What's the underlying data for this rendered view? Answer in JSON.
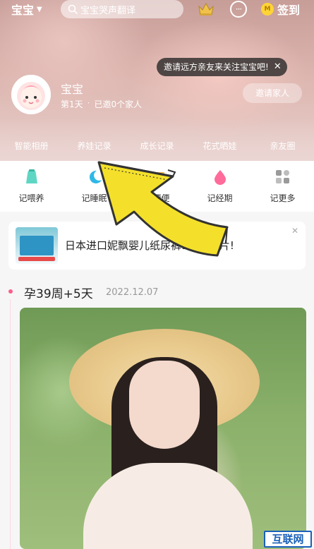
{
  "topbar": {
    "profile_name": "宝宝",
    "search_placeholder": "宝宝哭声翻译",
    "checkin_label": "签到",
    "coin_icon": "M"
  },
  "tooltip": {
    "text": "邀请远方亲友来关注宝宝吧!",
    "close": "✕"
  },
  "baby": {
    "name": "宝宝",
    "day": "第1天",
    "family": "已邀0个家人",
    "invite_button": "邀请家人"
  },
  "tabs": [
    "智能相册",
    "养娃记录",
    "成长记录",
    "花式晒娃",
    "亲友圈"
  ],
  "quick_actions": [
    {
      "label": "记喂养",
      "icon": "bottle-icon",
      "color": "#5fd6c4"
    },
    {
      "label": "记睡眠",
      "icon": "moon-icon",
      "color": "#2fb8e6"
    },
    {
      "label": "记便便",
      "icon": "diaper-icon",
      "color": "#f5b642"
    },
    {
      "label": "记经期",
      "icon": "drop-icon",
      "color": "#ff6b9a"
    },
    {
      "label": "记更多",
      "icon": "grid-icon",
      "color": "#9a9a9a"
    }
  ],
  "ad": {
    "text": "日本进口妮飘婴儿纸尿裤9.9元一片!",
    "close": "✕"
  },
  "timeline": {
    "title": "孕39周+5天",
    "date": "2022.12.07"
  },
  "watermark": "互联网",
  "colors": {
    "accent": "#ff5c8a",
    "arrow": "#f4e02a"
  }
}
